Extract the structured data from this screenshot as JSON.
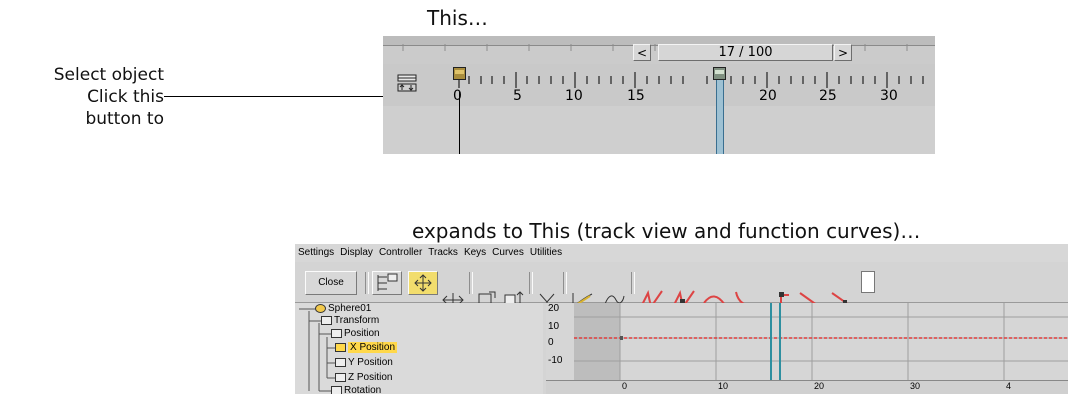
{
  "captions": {
    "this": "This…",
    "expands": "expands to This (track view and function curves)…"
  },
  "side_note": {
    "line1": "Select object",
    "line2": "Click this",
    "line3": "button to"
  },
  "timeline": {
    "prev_button": "<",
    "next_button": ">",
    "frame_indicator": "17 / 100",
    "current_frame": 17,
    "total_frames": 100,
    "tick_labels": [
      "0",
      "5",
      "10",
      "15",
      "20",
      "25",
      "30"
    ],
    "key_frames": [
      0,
      17
    ],
    "icons": {
      "toggle": "curve-editor-toggle-icon",
      "key": "keyframe-marker-icon"
    }
  },
  "trackview": {
    "menu": [
      "Settings",
      "Display",
      "Controller",
      "Tracks",
      "Keys",
      "Curves",
      "Utilities"
    ],
    "close_label": "Close",
    "toolbar_icons": [
      "filters-icon",
      "move-keys-icon",
      "slide-keys-icon",
      "scale-keys-icon",
      "scale-values-icon",
      "add-keys-icon",
      "draw-curves-icon",
      "reduce-keys-icon",
      "tangent-auto-icon",
      "tangent-custom-icon",
      "tangent-fast-icon",
      "tangent-slow-icon",
      "tangent-step-icon",
      "tangent-linear-icon",
      "tangent-smooth-icon"
    ],
    "tree": [
      {
        "label": "Sphere01",
        "icon": "object-icon"
      },
      {
        "label": "Transform",
        "icon": "transform-icon"
      },
      {
        "label": "Position",
        "icon": "position-icon"
      },
      {
        "label": "X Position",
        "icon": "x-position-icon",
        "selected": true
      },
      {
        "label": "Y Position",
        "icon": "y-position-icon"
      },
      {
        "label": "Z Position",
        "icon": "z-position-icon"
      },
      {
        "label": "Rotation",
        "icon": "rotation-icon"
      }
    ],
    "y_labels": [
      "20",
      "10",
      "0",
      "-10"
    ],
    "x_labels": [
      "0",
      "10",
      "20",
      "30",
      "4"
    ],
    "curve_color": "#e03c3c",
    "frame_marker_color": "#2e8fa0"
  }
}
